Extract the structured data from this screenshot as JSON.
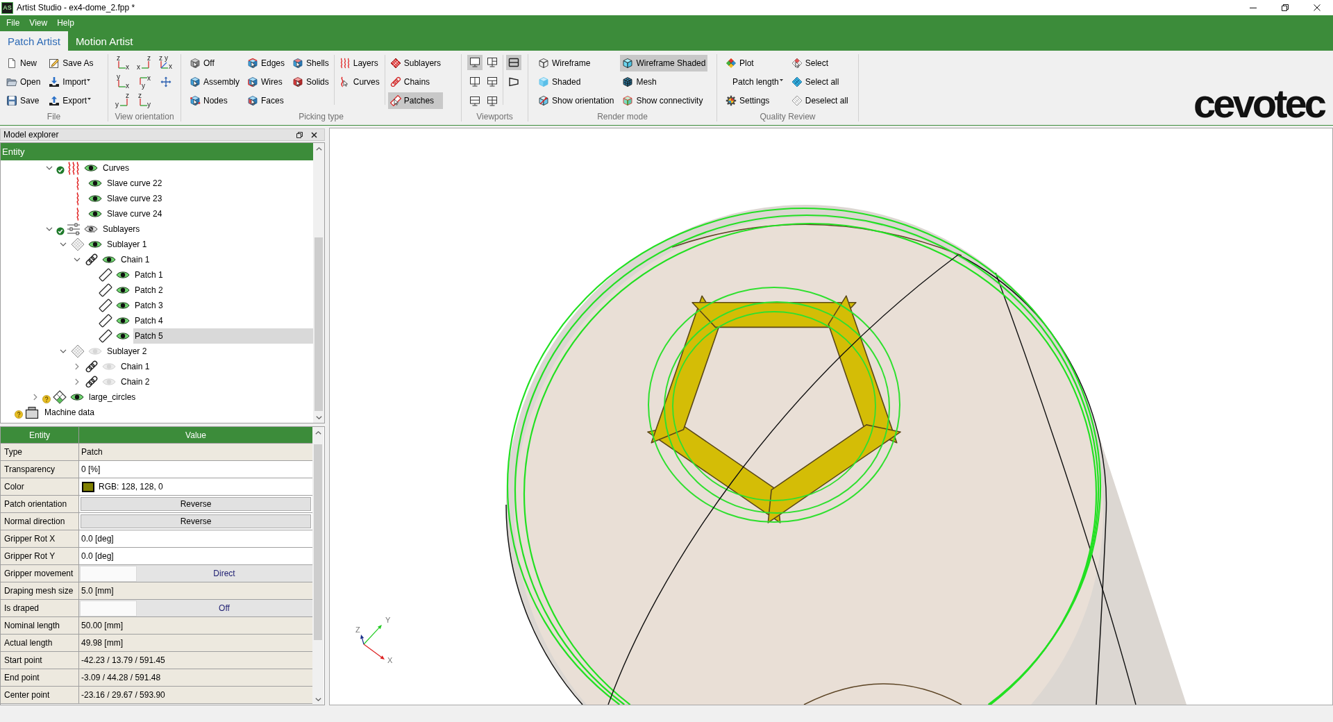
{
  "window": {
    "app_icon": "AS",
    "title": "Artist Studio - ex4-dome_2.fpp *"
  },
  "menu": [
    "File",
    "View",
    "Help"
  ],
  "tabs": [
    {
      "label": "Patch Artist",
      "selected": true
    },
    {
      "label": "Motion Artist",
      "selected": false
    }
  ],
  "ribbon": {
    "groups": [
      {
        "label": "File",
        "kind": "buttons",
        "sections": [
          [
            [
              {
                "label": "New"
              },
              {
                "label": "Open"
              },
              {
                "label": "Save"
              }
            ],
            [
              {
                "label": "Save As"
              },
              {
                "label": "Import",
                "dropdown": true
              },
              {
                "label": "Export",
                "dropdown": true
              }
            ]
          ]
        ]
      },
      {
        "label": "View orientation",
        "kind": "axes",
        "buttons": [
          {
            "kind": "axes",
            "vertical": "z",
            "horizontal": "x"
          },
          {
            "kind": "axes",
            "vertical": "z",
            "horizontal": "x"
          },
          {
            "kind": "axes",
            "vertical": "z",
            "depth": "y",
            "horizontal": "x"
          },
          {
            "kind": "axes",
            "vertical": "y",
            "horizontal": "x"
          },
          {
            "kind": "axes",
            "vertical": "y",
            "horizontal": "x"
          },
          {
            "kind": "pan"
          },
          {
            "kind": "axes",
            "vertical": "z",
            "horizontal": "y"
          },
          {
            "kind": "axes",
            "vertical": "z",
            "horizontal": "y"
          }
        ]
      },
      {
        "label": "Picking type",
        "kind": "buttons",
        "sections": [
          [
            [
              {
                "label": "Off",
                "selected": false
              },
              {
                "label": "Assembly",
                "selected": false
              },
              {
                "label": "Nodes",
                "selected": false
              }
            ],
            [
              {
                "label": "Edges",
                "selected": false
              },
              {
                "label": "Wires",
                "selected": false
              },
              {
                "label": "Faces",
                "selected": false
              }
            ],
            [
              {
                "label": "Shells",
                "selected": false
              },
              {
                "label": "Solids",
                "selected": false
              }
            ]
          ],
          [
            [
              {
                "label": "Layers",
                "selected": false
              },
              {
                "label": "Curves",
                "selected": false
              }
            ]
          ],
          [
            [
              {
                "label": "Sublayers",
                "selected": false
              },
              {
                "label": "Chains",
                "selected": false
              },
              {
                "label": "Patches",
                "selected": true
              }
            ]
          ]
        ]
      },
      {
        "label": "Viewports",
        "kind": "icons",
        "sections": [
          [
            [
              {
                "kind": "single",
                "selected": true
              },
              {
                "kind": "split_vertical",
                "selected": false
              },
              {
                "kind": "split_horizontal",
                "selected": false
              }
            ],
            [
              {
                "kind": "three_right",
                "selected": false
              },
              {
                "kind": "three_left",
                "selected": false
              },
              {
                "kind": "four",
                "selected": false
              }
            ]
          ],
          [
            [
              {
                "kind": "frame",
                "selected": true
              },
              {
                "kind": "perspective",
                "selected": false
              }
            ]
          ]
        ]
      },
      {
        "label": "Render mode",
        "kind": "buttons",
        "sections": [
          [
            [
              {
                "label": "Wireframe",
                "selected": false
              },
              {
                "label": "Shaded",
                "selected": false
              },
              {
                "label": "Show orientation",
                "selected": false
              }
            ],
            [
              {
                "label": "Wireframe Shaded",
                "selected": true
              },
              {
                "label": "Mesh",
                "selected": false
              },
              {
                "label": "Show connectivity",
                "selected": false
              }
            ]
          ]
        ]
      },
      {
        "label": "Quality Review",
        "kind": "buttons",
        "sections": [
          [
            [
              {
                "label": "Plot"
              },
              {
                "label": "Patch length",
                "dropdown": true
              },
              {
                "label": "Settings"
              }
            ],
            [
              {
                "label": "Select"
              },
              {
                "label": "Select all"
              },
              {
                "label": "Deselect all"
              }
            ]
          ]
        ]
      }
    ],
    "logo": "cevotec"
  },
  "model_explorer": {
    "title": "Model explorer",
    "column": "Entity",
    "tree": [
      {
        "children": [
          {
            "children": [
              {
                "children": [
                  {
                    "label": "Curves",
                    "kind": "curves",
                    "valid": true,
                    "visible": true,
                    "expanded": true,
                    "selected": false,
                    "children": [
                      {
                        "label": "Slave curve 22",
                        "kind": "curve",
                        "visible": true,
                        "selected": false
                      },
                      {
                        "label": "Slave curve 23",
                        "kind": "curve",
                        "visible": true,
                        "selected": false
                      },
                      {
                        "label": "Slave curve 24",
                        "kind": "curve",
                        "visible": true,
                        "selected": false
                      }
                    ]
                  },
                  {
                    "label": "Sublayers",
                    "kind": "sublayers",
                    "valid": true,
                    "visible": true,
                    "partial": true,
                    "expanded": true,
                    "selected": false,
                    "children": [
                      {
                        "label": "Sublayer 1",
                        "kind": "sublayer",
                        "visible": true,
                        "expanded": true,
                        "selected": false,
                        "children": [
                          {
                            "label": "Chain 1",
                            "kind": "chain",
                            "visible": true,
                            "expanded": true,
                            "selected": false,
                            "children": [
                              {
                                "label": "Patch 1",
                                "kind": "patch",
                                "visible": true,
                                "selected": false
                              },
                              {
                                "label": "Patch 2",
                                "kind": "patch",
                                "visible": true,
                                "selected": false
                              },
                              {
                                "label": "Patch 3",
                                "kind": "patch",
                                "visible": true,
                                "selected": false
                              },
                              {
                                "label": "Patch 4",
                                "kind": "patch",
                                "visible": true,
                                "selected": false
                              },
                              {
                                "label": "Patch 5",
                                "kind": "patch",
                                "visible": true,
                                "selected": true
                              }
                            ]
                          }
                        ]
                      },
                      {
                        "label": "Sublayer 2",
                        "kind": "sublayer",
                        "visible": false,
                        "expanded": true,
                        "selected": false,
                        "children": [
                          {
                            "label": "Chain 1",
                            "kind": "chain",
                            "visible": false,
                            "expanded": false,
                            "selected": false
                          },
                          {
                            "label": "Chain 2",
                            "kind": "chain",
                            "visible": false,
                            "expanded": false,
                            "selected": false
                          }
                        ]
                      }
                    ]
                  }
                ]
              },
              {
                "label": "large_circles",
                "kind": "circles",
                "valid": false,
                "visible": true,
                "expanded": false,
                "selected": false
              }
            ]
          }
        ]
      },
      {
        "label": "Machine data",
        "kind": "machine",
        "valid": false,
        "selected": false
      }
    ]
  },
  "properties": {
    "columns": [
      "Entity",
      "Value"
    ],
    "rows": [
      {
        "name": "Type",
        "kind": "readonly",
        "value": "Patch"
      },
      {
        "name": "Transparency",
        "kind": "editable",
        "value": "0 [%]"
      },
      {
        "name": "Color",
        "kind": "color",
        "color": "#808000",
        "value": "RGB: 128, 128, 0"
      },
      {
        "name": "Patch orientation",
        "kind": "button",
        "value": "Reverse"
      },
      {
        "name": "Normal direction",
        "kind": "button",
        "value": "Reverse"
      },
      {
        "name": "Gripper Rot X",
        "kind": "editable",
        "value": "0.0 [deg]"
      },
      {
        "name": "Gripper Rot Y",
        "kind": "editable",
        "value": "0.0 [deg]"
      },
      {
        "name": "Gripper movement",
        "kind": "toggle",
        "on": false,
        "value": "Direct"
      },
      {
        "name": "Draping mesh size",
        "kind": "readonly",
        "value": "5.0 [mm]"
      },
      {
        "name": "Is draped",
        "kind": "toggle",
        "on": false,
        "value": "Off"
      },
      {
        "name": "Nominal length",
        "kind": "readonly",
        "value": "50.00 [mm]"
      },
      {
        "name": "Actual length",
        "kind": "readonly",
        "value": "49.98 [mm]"
      },
      {
        "name": "Start point",
        "kind": "readonly",
        "value": "-42.23 / 13.79 / 591.45"
      },
      {
        "name": "End point",
        "kind": "readonly",
        "value": "-3.09 / 44.28 / 591.48"
      },
      {
        "name": "Center point",
        "kind": "readonly",
        "value": "-23.16 / 29.67 / 593.90"
      }
    ]
  },
  "viewport": {
    "axes": {
      "x": "X",
      "y": "Y",
      "z": "Z"
    }
  }
}
